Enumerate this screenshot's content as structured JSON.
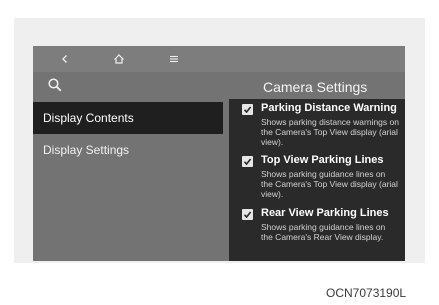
{
  "screen": {
    "title": "Camera Settings"
  },
  "topbar": {
    "icons": [
      "back-icon",
      "home-icon",
      "menu-icon"
    ]
  },
  "sidebar": {
    "items": [
      {
        "label": "Display Contents",
        "selected": true
      },
      {
        "label": "Display Settings",
        "selected": false
      }
    ]
  },
  "options": [
    {
      "title": "Parking Distance Warning",
      "description": "Shows parking distance warnings on the Camera's Top View display (arial view).",
      "checked": true
    },
    {
      "title": "Top View Parking Lines",
      "description": "Shows parking guidance lines on the Camera's Top View display (arial view).",
      "checked": true
    },
    {
      "title": "Rear View Parking Lines",
      "description": "Shows parking guidance lines on the Camera's Rear View display.",
      "checked": true
    }
  ],
  "figure_code": "OCN7073190L",
  "colors": {
    "screen_bg": "#737373",
    "selected_bg": "#1f1f1f",
    "panel_bg": "#2a2a2a"
  }
}
